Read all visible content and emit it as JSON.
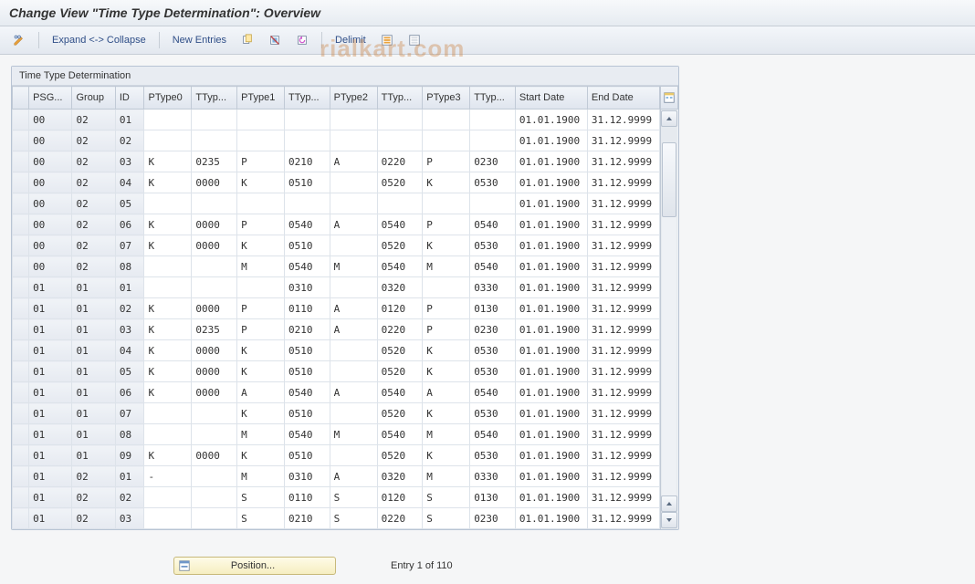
{
  "title": "Change View \"Time Type Determination\": Overview",
  "toolbar": {
    "expand_collapse": "Expand <-> Collapse",
    "new_entries": "New Entries",
    "delimit": "Delimit"
  },
  "panel": {
    "title": "Time Type Determination"
  },
  "columns": [
    "PSG...",
    "Group",
    "ID",
    "PType0",
    "TTyp...",
    "PType1",
    "TTyp...",
    "PType2",
    "TTyp...",
    "PType3",
    "TTyp...",
    "Start Date",
    "End Date"
  ],
  "rows": [
    {
      "psg": "00",
      "group": "02",
      "id": "01",
      "pt0": "",
      "tt0": "",
      "pt1": "",
      "tt1": "",
      "pt2": "",
      "tt2": "",
      "pt3": "",
      "tt3": "",
      "start": "01.01.1900",
      "end": "31.12.9999"
    },
    {
      "psg": "00",
      "group": "02",
      "id": "02",
      "pt0": "",
      "tt0": "",
      "pt1": "",
      "tt1": "",
      "pt2": "",
      "tt2": "",
      "pt3": "",
      "tt3": "",
      "start": "01.01.1900",
      "end": "31.12.9999"
    },
    {
      "psg": "00",
      "group": "02",
      "id": "03",
      "pt0": "K",
      "tt0": "0235",
      "pt1": "P",
      "tt1": "0210",
      "pt2": "A",
      "tt2": "0220",
      "pt3": "P",
      "tt3": "0230",
      "start": "01.01.1900",
      "end": "31.12.9999"
    },
    {
      "psg": "00",
      "group": "02",
      "id": "04",
      "pt0": "K",
      "tt0": "0000",
      "pt1": "K",
      "tt1": "0510",
      "pt2": "",
      "tt2": "0520",
      "pt3": "K",
      "tt3": "0530",
      "start": "01.01.1900",
      "end": "31.12.9999"
    },
    {
      "psg": "00",
      "group": "02",
      "id": "05",
      "pt0": "",
      "tt0": "",
      "pt1": "",
      "tt1": "",
      "pt2": "",
      "tt2": "",
      "pt3": "",
      "tt3": "",
      "start": "01.01.1900",
      "end": "31.12.9999"
    },
    {
      "psg": "00",
      "group": "02",
      "id": "06",
      "pt0": "K",
      "tt0": "0000",
      "pt1": "P",
      "tt1": "0540",
      "pt2": "A",
      "tt2": "0540",
      "pt3": "P",
      "tt3": "0540",
      "start": "01.01.1900",
      "end": "31.12.9999"
    },
    {
      "psg": "00",
      "group": "02",
      "id": "07",
      "pt0": "K",
      "tt0": "0000",
      "pt1": "K",
      "tt1": "0510",
      "pt2": "",
      "tt2": "0520",
      "pt3": "K",
      "tt3": "0530",
      "start": "01.01.1900",
      "end": "31.12.9999"
    },
    {
      "psg": "00",
      "group": "02",
      "id": "08",
      "pt0": "",
      "tt0": "",
      "pt1": "M",
      "tt1": "0540",
      "pt2": "M",
      "tt2": "0540",
      "pt3": "M",
      "tt3": "0540",
      "start": "01.01.1900",
      "end": "31.12.9999"
    },
    {
      "psg": "01",
      "group": "01",
      "id": "01",
      "pt0": "",
      "tt0": "",
      "pt1": "",
      "tt1": "0310",
      "pt2": "",
      "tt2": "0320",
      "pt3": "",
      "tt3": "0330",
      "start": "01.01.1900",
      "end": "31.12.9999"
    },
    {
      "psg": "01",
      "group": "01",
      "id": "02",
      "pt0": "K",
      "tt0": "0000",
      "pt1": "P",
      "tt1": "0110",
      "pt2": "A",
      "tt2": "0120",
      "pt3": "P",
      "tt3": "0130",
      "start": "01.01.1900",
      "end": "31.12.9999"
    },
    {
      "psg": "01",
      "group": "01",
      "id": "03",
      "pt0": "K",
      "tt0": "0235",
      "pt1": "P",
      "tt1": "0210",
      "pt2": "A",
      "tt2": "0220",
      "pt3": "P",
      "tt3": "0230",
      "start": "01.01.1900",
      "end": "31.12.9999"
    },
    {
      "psg": "01",
      "group": "01",
      "id": "04",
      "pt0": "K",
      "tt0": "0000",
      "pt1": "K",
      "tt1": "0510",
      "pt2": "",
      "tt2": "0520",
      "pt3": "K",
      "tt3": "0530",
      "start": "01.01.1900",
      "end": "31.12.9999"
    },
    {
      "psg": "01",
      "group": "01",
      "id": "05",
      "pt0": "K",
      "tt0": "0000",
      "pt1": "K",
      "tt1": "0510",
      "pt2": "",
      "tt2": "0520",
      "pt3": "K",
      "tt3": "0530",
      "start": "01.01.1900",
      "end": "31.12.9999"
    },
    {
      "psg": "01",
      "group": "01",
      "id": "06",
      "pt0": "K",
      "tt0": "0000",
      "pt1": "A",
      "tt1": "0540",
      "pt2": "A",
      "tt2": "0540",
      "pt3": "A",
      "tt3": "0540",
      "start": "01.01.1900",
      "end": "31.12.9999"
    },
    {
      "psg": "01",
      "group": "01",
      "id": "07",
      "pt0": "",
      "tt0": "",
      "pt1": "K",
      "tt1": "0510",
      "pt2": "",
      "tt2": "0520",
      "pt3": "K",
      "tt3": "0530",
      "start": "01.01.1900",
      "end": "31.12.9999"
    },
    {
      "psg": "01",
      "group": "01",
      "id": "08",
      "pt0": "",
      "tt0": "",
      "pt1": "M",
      "tt1": "0540",
      "pt2": "M",
      "tt2": "0540",
      "pt3": "M",
      "tt3": "0540",
      "start": "01.01.1900",
      "end": "31.12.9999"
    },
    {
      "psg": "01",
      "group": "01",
      "id": "09",
      "pt0": "K",
      "tt0": "0000",
      "pt1": "K",
      "tt1": "0510",
      "pt2": "",
      "tt2": "0520",
      "pt3": "K",
      "tt3": "0530",
      "start": "01.01.1900",
      "end": "31.12.9999"
    },
    {
      "psg": "01",
      "group": "02",
      "id": "01",
      "pt0": "-",
      "tt0": "",
      "pt1": "M",
      "tt1": "0310",
      "pt2": "A",
      "tt2": "0320",
      "pt3": "M",
      "tt3": "0330",
      "start": "01.01.1900",
      "end": "31.12.9999"
    },
    {
      "psg": "01",
      "group": "02",
      "id": "02",
      "pt0": "",
      "tt0": "",
      "pt1": "S",
      "tt1": "0110",
      "pt2": "S",
      "tt2": "0120",
      "pt3": "S",
      "tt3": "0130",
      "start": "01.01.1900",
      "end": "31.12.9999"
    },
    {
      "psg": "01",
      "group": "02",
      "id": "03",
      "pt0": "",
      "tt0": "",
      "pt1": "S",
      "tt1": "0210",
      "pt2": "S",
      "tt2": "0220",
      "pt3": "S",
      "tt3": "0230",
      "start": "01.01.1900",
      "end": "31.12.9999"
    }
  ],
  "footer": {
    "position_label": "Position...",
    "entry_text": "Entry 1 of 110"
  },
  "watermark": "rialkart.com"
}
